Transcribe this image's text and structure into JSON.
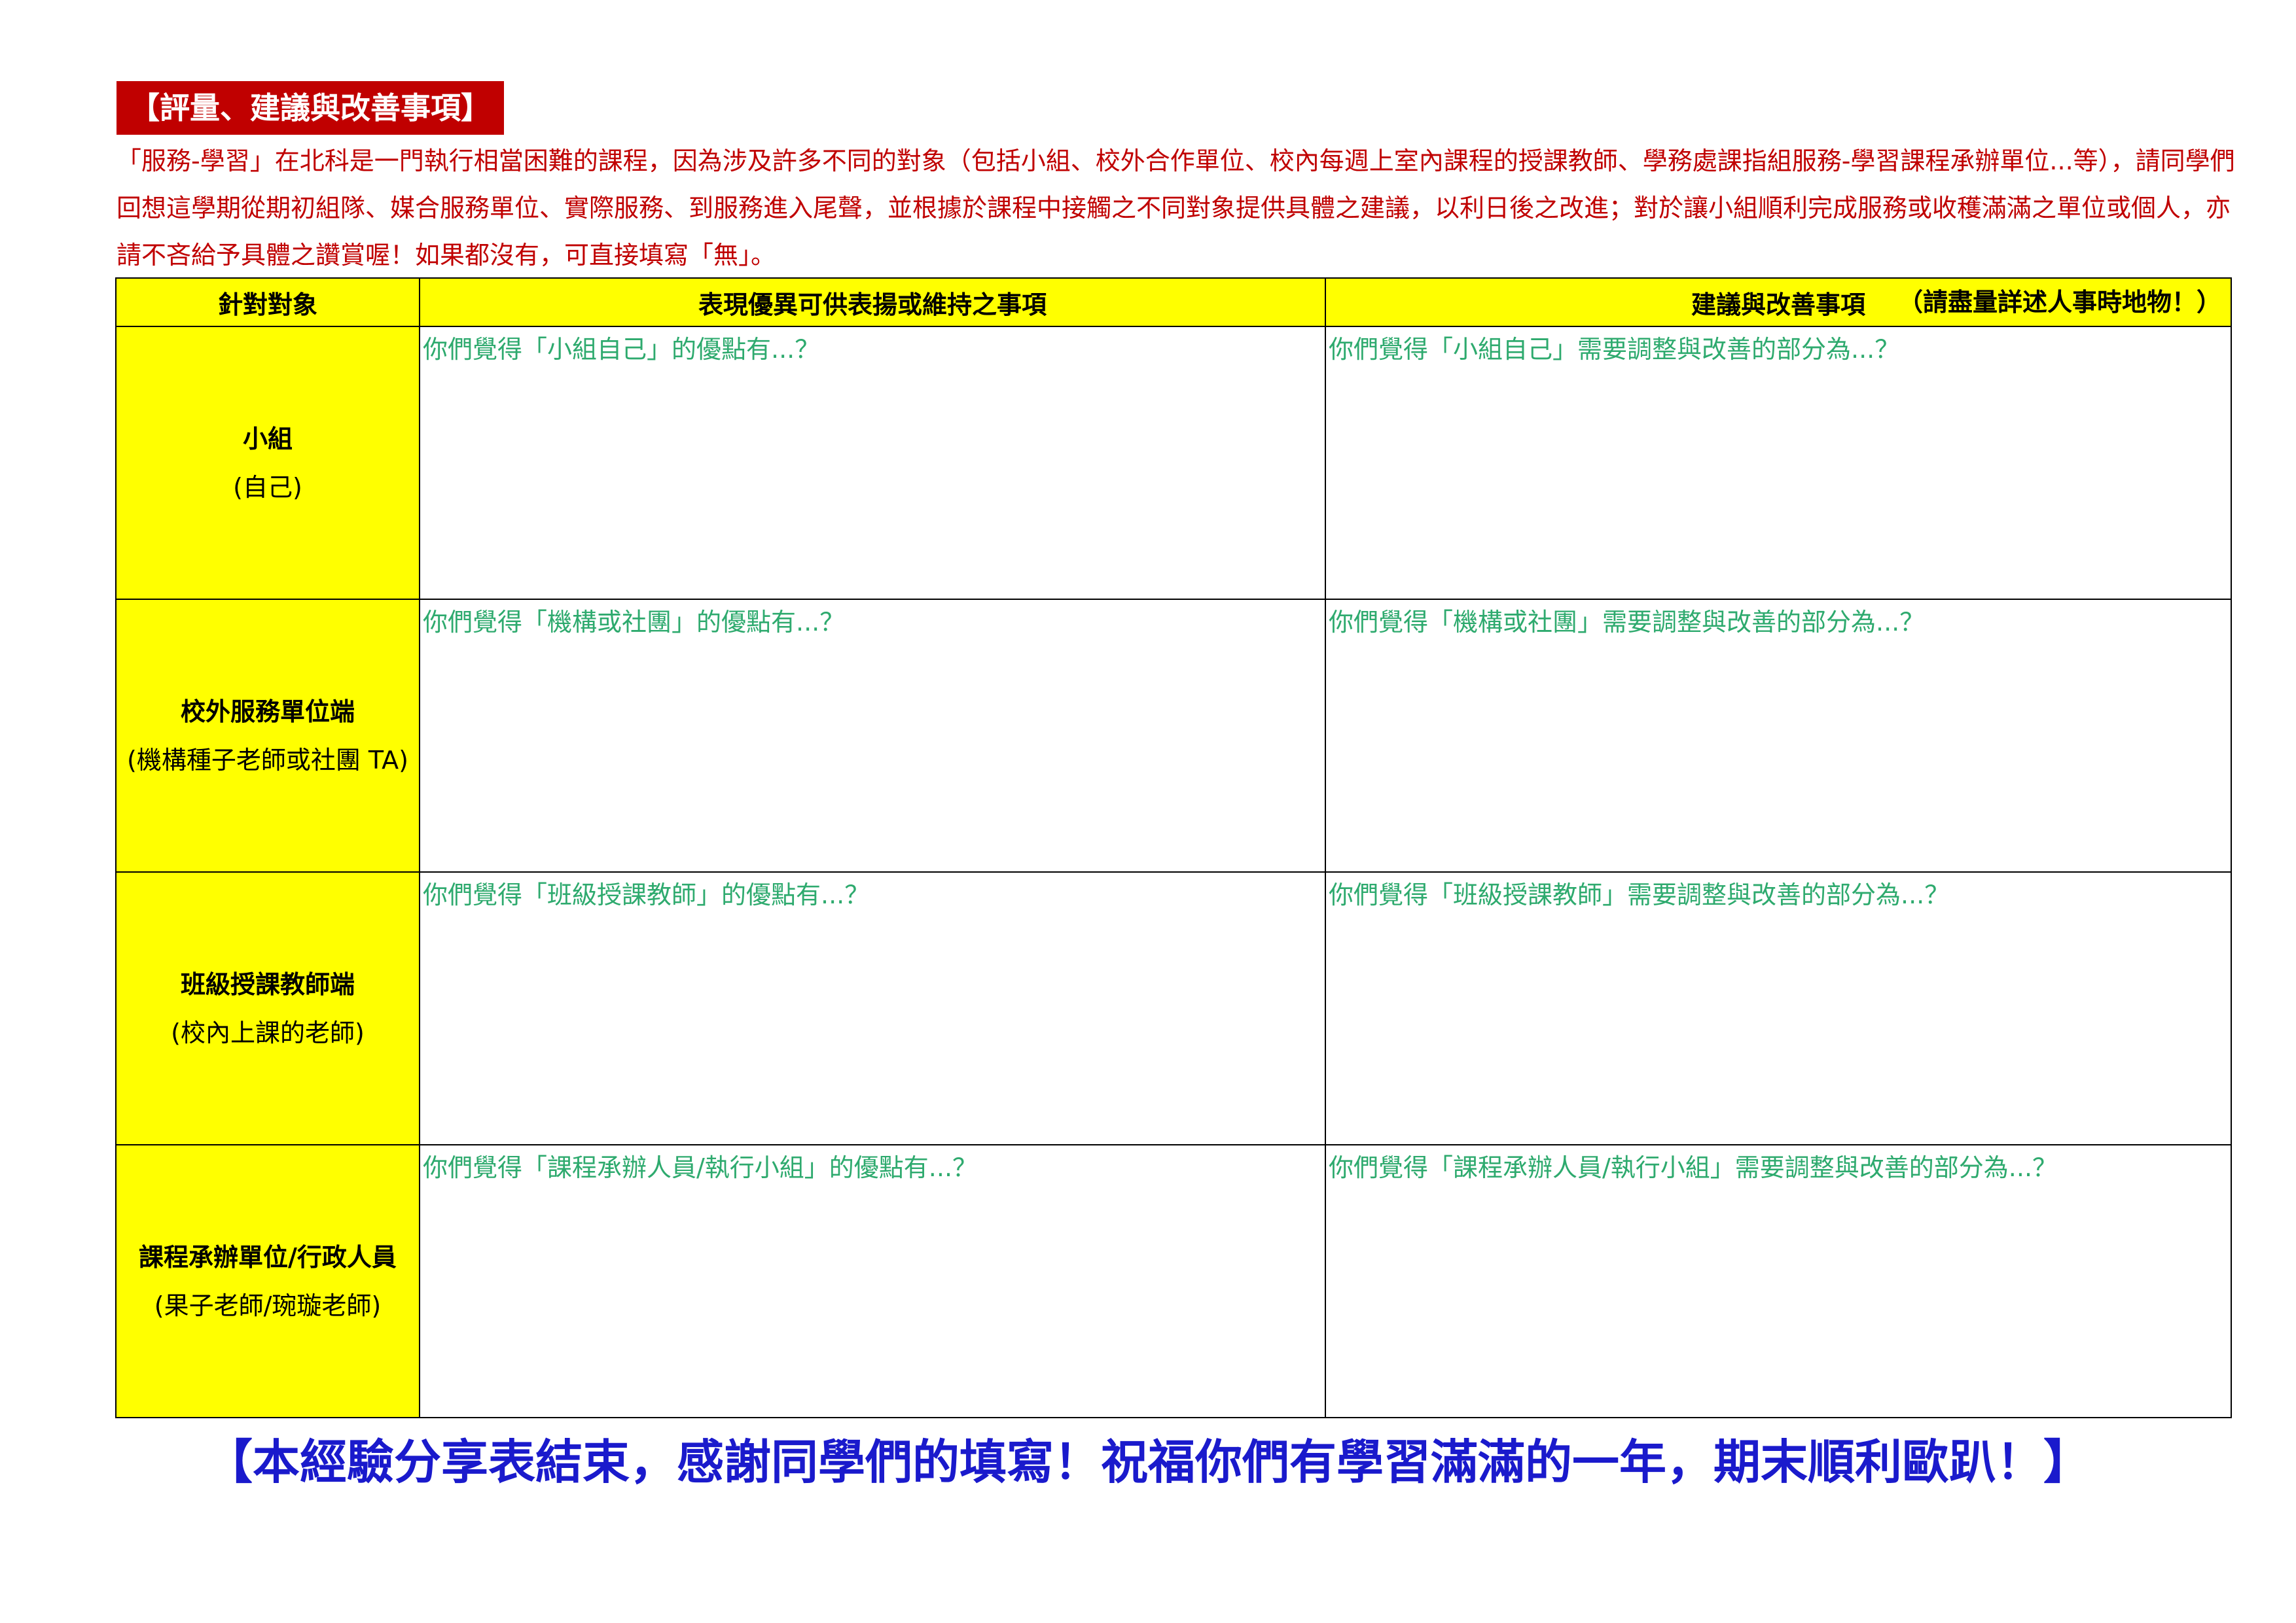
{
  "section_title": "【評量、建議與改善事項】",
  "intro_text": "「服務-學習」在北科是一門執行相當困難的課程，因為涉及許多不同的對象（包括小組、校外合作單位、校內每週上室內課程的授課教師、學務處課指組服務-學習課程承辦單位...等），請同學們回想這學期從期初組隊、媒合服務單位、實際服務、到服務進入尾聲，並根據於課程中接觸之不同對象提供具體之建議，以利日後之改進；對於讓小組順利完成服務或收穫滿滿之單位或個人，亦請不吝給予具體之讚賞喔！如果都沒有，可直接填寫「無」。",
  "table": {
    "headers": {
      "target": "針對對象",
      "praise": "表現優異可供表揚或維持之事項",
      "suggest": "建議與改善事項",
      "suggest_note": "（請盡量詳述人事時地物！）"
    },
    "rows": [
      {
        "target_main": "小組",
        "target_sub": "(自己)",
        "praise_prompt": "你們覺得「小組自己」的優點有...？",
        "suggest_prompt": "你們覺得「小組自己」需要調整與改善的部分為...？"
      },
      {
        "target_main": "校外服務單位端",
        "target_sub": "(機構種子老師或社團 TA)",
        "praise_prompt": "你們覺得「機構或社團」的優點有...？",
        "suggest_prompt": "你們覺得「機構或社團」需要調整與改善的部分為...？"
      },
      {
        "target_main": "班級授課教師端",
        "target_sub": "(校內上課的老師)",
        "praise_prompt": "你們覺得「班級授課教師」的優點有...？",
        "suggest_prompt": "你們覺得「班級授課教師」需要調整與改善的部分為...？"
      },
      {
        "target_main": "課程承辦單位/行政人員",
        "target_sub": "(果子老師/琬璇老師)",
        "praise_prompt": "你們覺得「課程承辦人員/執行小組」的優點有...？",
        "suggest_prompt": "你們覺得「課程承辦人員/執行小組」需要調整與改善的部分為...？"
      }
    ]
  },
  "closing_text": "【本經驗分享表結束，感謝同學們的填寫！祝福你們有學習滿滿的一年，期末順利歐趴！】",
  "colors": {
    "title_bg": "#c00000",
    "intro_text": "#c00000",
    "header_bg": "#ffff00",
    "prompt_text": "#2eaa6e",
    "closing_text": "#1a1acc"
  }
}
